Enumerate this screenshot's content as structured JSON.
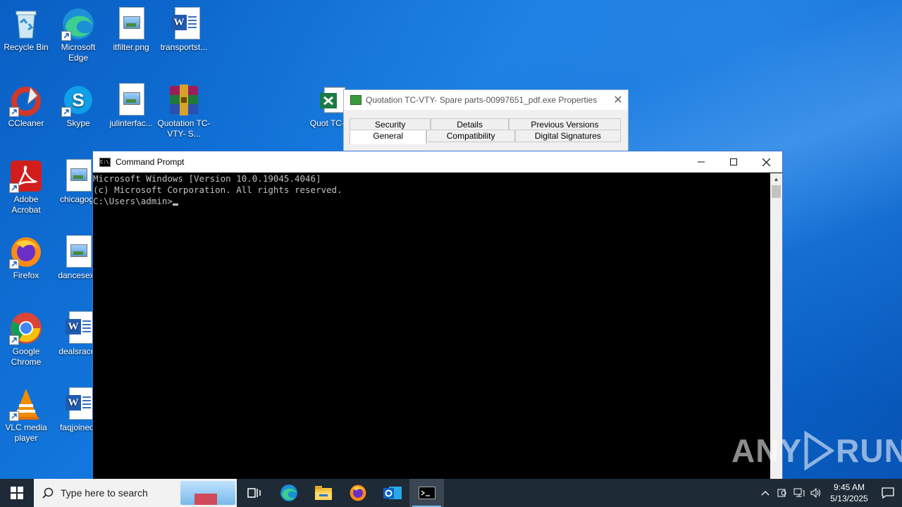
{
  "desktop": {
    "icons": [
      {
        "label": "Recycle Bin"
      },
      {
        "label": "Microsoft Edge"
      },
      {
        "label": "itfilter.png"
      },
      {
        "label": "transportst..."
      },
      {
        "label": "CCleaner"
      },
      {
        "label": "Skype"
      },
      {
        "label": "julinterfac..."
      },
      {
        "label": "Quotation TC-VTY- S..."
      },
      {
        "label": "Quot TC-VT"
      },
      {
        "label": "Adobe Acrobat"
      },
      {
        "label": "chicagogr"
      },
      {
        "label": "Firefox"
      },
      {
        "label": "dancesexy"
      },
      {
        "label": "Google Chrome"
      },
      {
        "label": "dealsrace."
      },
      {
        "label": "VLC media player"
      },
      {
        "label": "faqjoined."
      }
    ]
  },
  "properties_window": {
    "title": "Quotation TC-VTY- Spare parts-00997651_pdf.exe Properties",
    "tabs_row1": [
      "Security",
      "Details",
      "Previous Versions"
    ],
    "tabs_row2": [
      "General",
      "Compatibility",
      "Digital Signatures"
    ],
    "selected_tab": "General"
  },
  "cmd_window": {
    "title": "Command Prompt",
    "lines": [
      "Microsoft Windows [Version 10.0.19045.4046]",
      "(c) Microsoft Corporation. All rights reserved.",
      "",
      "C:\\Users\\admin>"
    ]
  },
  "watermark": {
    "left": "ANY",
    "right": "RUN"
  },
  "taskbar": {
    "search_placeholder": "Type here to search",
    "pinned": [
      "task-view",
      "edge",
      "file-explorer",
      "firefox",
      "outlook",
      "command-prompt"
    ],
    "time": "9:45 AM",
    "date": "5/13/2025"
  },
  "colors": {
    "accent": "#0a66d0",
    "taskbar": "#1e2a36",
    "console_text": "#c0c0c0"
  }
}
